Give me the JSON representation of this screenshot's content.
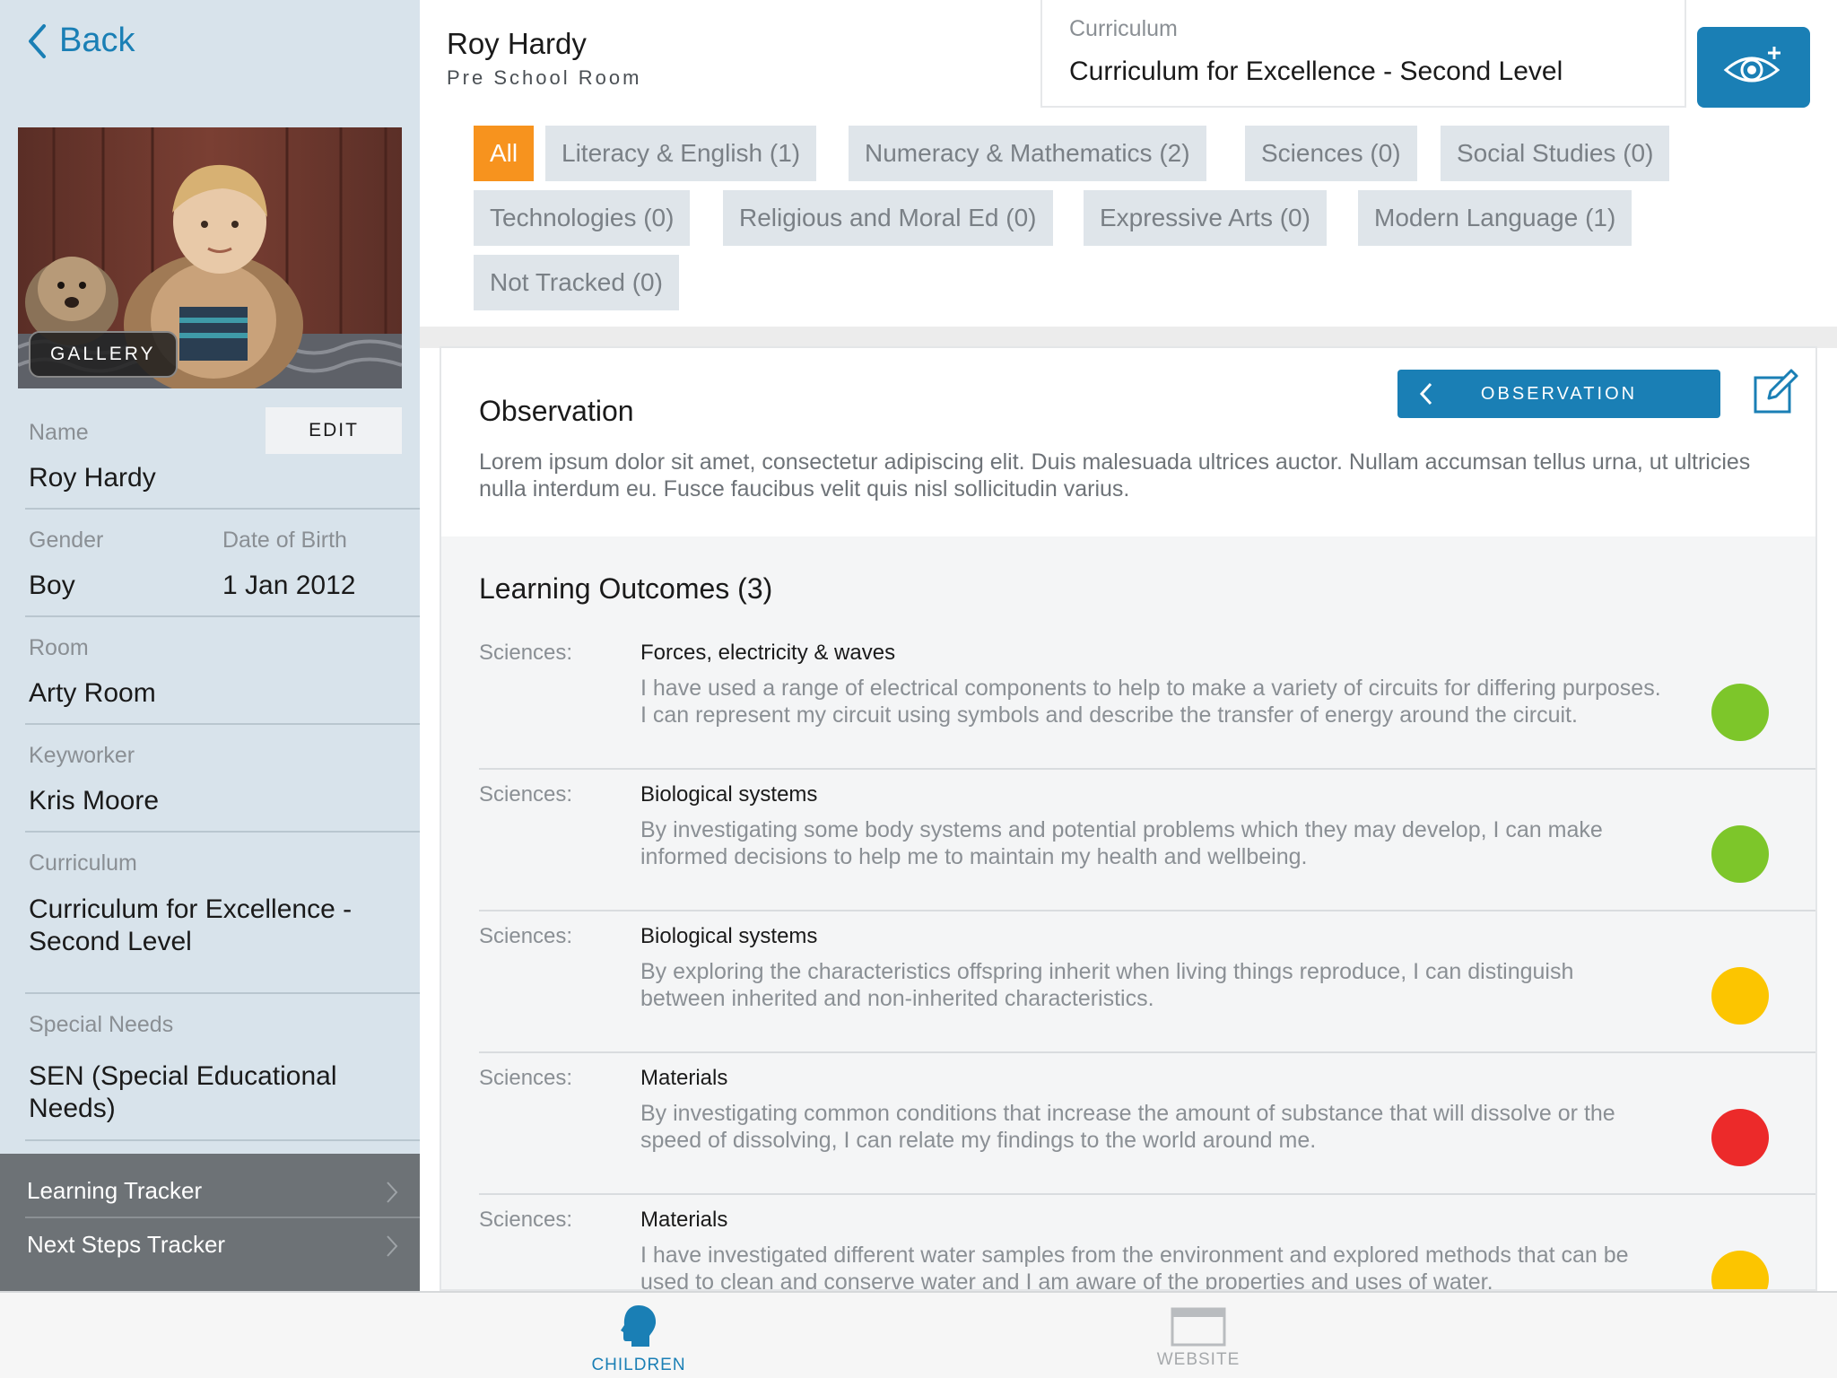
{
  "nav": {
    "back_label": "Back"
  },
  "profile": {
    "gallery_label": "GALLERY",
    "edit_label": "EDIT",
    "name_label": "Name",
    "name_value": "Roy Hardy",
    "gender_label": "Gender",
    "gender_value": "Boy",
    "dob_label": "Date of Birth",
    "dob_value": "1 Jan 2012",
    "room_label": "Room",
    "room_value": "Arty Room",
    "keyworker_label": "Keyworker",
    "keyworker_value": "Kris Moore",
    "curriculum_label": "Curriculum",
    "curriculum_value_line1": "Curriculum for Excellence -",
    "curriculum_value_line2": "Second Level",
    "special_needs_label": "Special Needs",
    "special_needs_line1": "SEN (Special Educational",
    "special_needs_line2": "Needs)"
  },
  "trackers": [
    {
      "label": "Learning Tracker"
    },
    {
      "label": "Next Steps Tracker"
    }
  ],
  "header": {
    "child_name": "Roy Hardy",
    "room": "Pre School Room",
    "curriculum_label": "Curriculum",
    "curriculum_value": "Curriculum for Excellence - Second Level"
  },
  "filters": [
    {
      "label": "All",
      "active": true
    },
    {
      "label": "Literacy & English (1)"
    },
    {
      "label": "Numeracy & Mathematics (2)"
    },
    {
      "label": "Sciences (0)"
    },
    {
      "label": "Social Studies (0)"
    },
    {
      "label": "Technologies (0)"
    },
    {
      "label": "Religious and Moral Ed (0)"
    },
    {
      "label": "Expressive Arts (0)"
    },
    {
      "label": "Modern Language (1)"
    },
    {
      "label": "Not Tracked (0)"
    }
  ],
  "observation": {
    "title": "Observation",
    "button_label": "OBSERVATION",
    "text": "Lorem ipsum dolor sit amet, consectetur adipiscing elit. Duis malesuada ultrices auctor. Nullam accumsan tellus urna, ut ultricies nulla interdum eu. Fusce faucibus velit quis nisl sollicitudin varius."
  },
  "outcomes": {
    "title": "Learning Outcomes (3)",
    "items": [
      {
        "category": "Sciences:",
        "heading": "Forces, electricity & waves",
        "description": "I have used a range of electrical components to help to make a variety of circuits for differing purposes. I can represent my circuit using symbols and describe the transfer of energy around the circuit.",
        "status_color": "#7dc62a"
      },
      {
        "category": "Sciences:",
        "heading": "Biological systems",
        "description": "By investigating some body systems and potential problems which they may develop, I can make informed decisions to help me to maintain my health and wellbeing.",
        "status_color": "#7dc62a"
      },
      {
        "category": "Sciences:",
        "heading": "Biological systems",
        "description": "By exploring the characteristics offspring inherit when living things reproduce, I can distinguish between inherited and non-inherited characteristics.",
        "status_color": "#fcc500"
      },
      {
        "category": "Sciences:",
        "heading": "Materials",
        "description": "By investigating common conditions that increase the amount of substance that will dissolve or the speed of dissolving, I can relate my findings to the world around me.",
        "status_color": "#ec2a2a"
      },
      {
        "category": "Sciences:",
        "heading": "Materials",
        "description": "I have investigated different water samples from the environment and explored methods that can be used to clean and conserve water and I am aware of the properties and uses of water.",
        "status_color": "#fcc500"
      }
    ]
  },
  "tabbar": {
    "children_label": "CHILDREN",
    "website_label": "WEBSITE"
  },
  "colors": {
    "accent": "#1a7fb5",
    "active_filter": "#f7931e",
    "sidebar_bg": "#d8e3eb",
    "tracker_bg": "#6d7276"
  }
}
